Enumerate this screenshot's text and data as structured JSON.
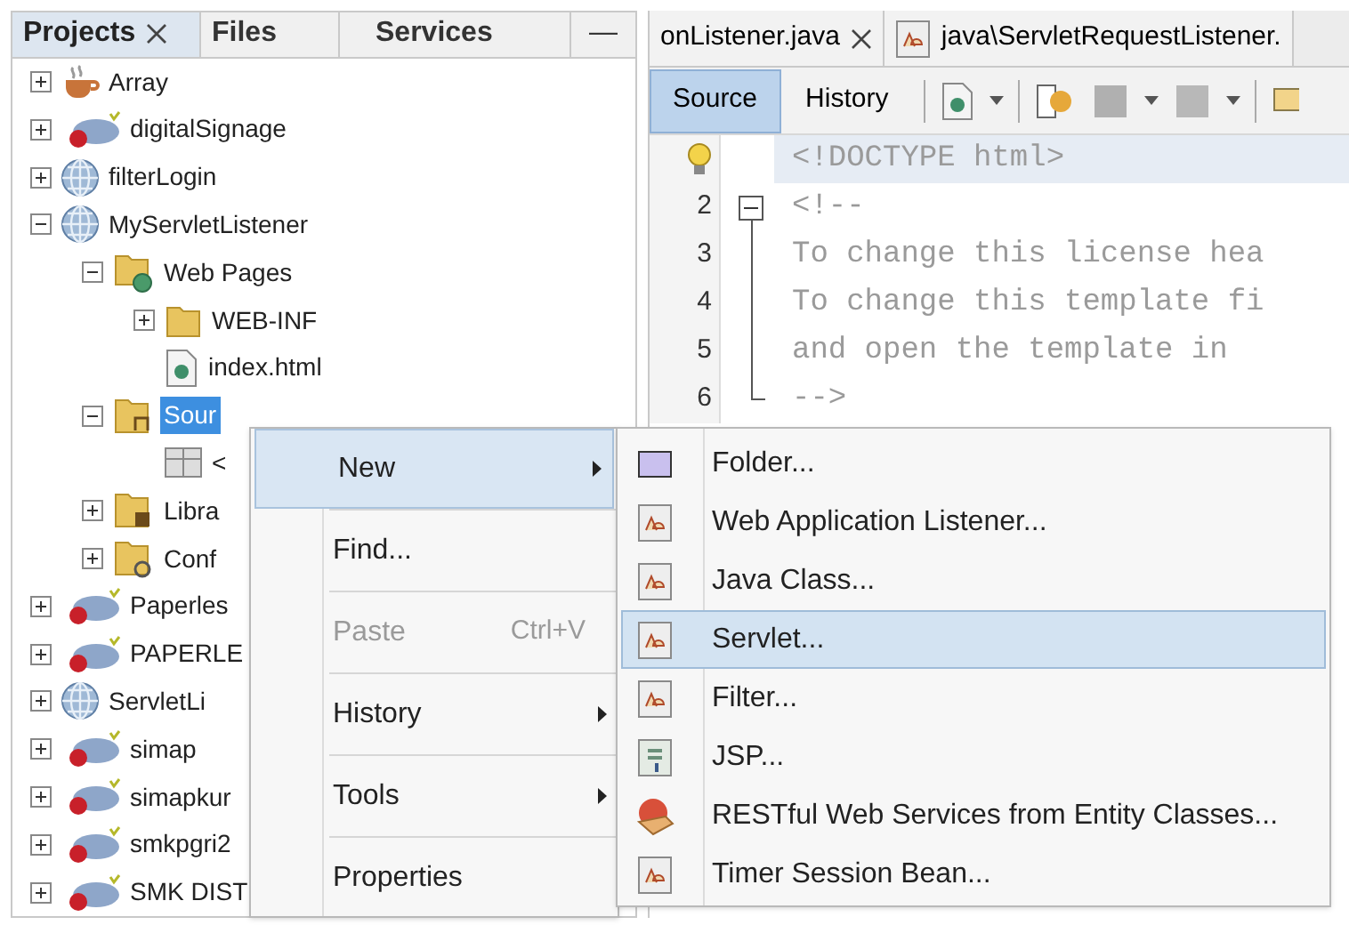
{
  "projects_panel": {
    "tabs": [
      {
        "label": "Projects",
        "selected": true,
        "closable": true
      },
      {
        "label": "Files",
        "selected": false,
        "closable": false
      },
      {
        "label": "Services",
        "selected": false,
        "closable": false
      }
    ],
    "minimize": "—",
    "tree": [
      {
        "label": "Array",
        "kind": "coffee",
        "expanded": false,
        "selected": false
      },
      {
        "label": "digitalSignage",
        "kind": "php",
        "expanded": false,
        "selected": false
      },
      {
        "label": "filterLogin",
        "kind": "globe",
        "expanded": false,
        "selected": false
      },
      {
        "label": "MyServletListener",
        "kind": "globe",
        "expanded": true,
        "selected": false,
        "children": [
          {
            "label": "Web Pages",
            "kind": "webfolder",
            "expanded": true,
            "selected": false,
            "children": [
              {
                "label": "WEB-INF",
                "kind": "folder",
                "expanded": false,
                "selected": false
              },
              {
                "label": "index.html",
                "kind": "html",
                "selected": false
              }
            ]
          },
          {
            "label": "Sour",
            "kind": "sourcefolder",
            "expanded": true,
            "selected": true,
            "children": [
              {
                "label": "<",
                "kind": "package",
                "selected": false
              }
            ]
          },
          {
            "label": "Libra",
            "kind": "libfolder",
            "expanded": false,
            "selected": false
          },
          {
            "label": "Conf",
            "kind": "conffolder",
            "expanded": false,
            "selected": false
          }
        ]
      },
      {
        "label": "Paperles",
        "kind": "php",
        "expanded": false,
        "selected": false
      },
      {
        "label": "PAPERLE",
        "kind": "php",
        "expanded": false,
        "selected": false
      },
      {
        "label": "ServletLi",
        "kind": "globe",
        "expanded": false,
        "selected": false
      },
      {
        "label": "simap",
        "kind": "php",
        "expanded": false,
        "selected": false
      },
      {
        "label": "simapkur",
        "kind": "php",
        "expanded": false,
        "selected": false
      },
      {
        "label": "smkpgri2",
        "kind": "php",
        "expanded": false,
        "selected": false
      },
      {
        "label": "SMK DIST",
        "kind": "php",
        "expanded": false,
        "selected": false
      }
    ]
  },
  "editor": {
    "file_tabs": [
      {
        "label": "onListener.java",
        "closable": true
      },
      {
        "label": "java\\ServletRequestListener.",
        "closable": false
      }
    ],
    "view_tabs": [
      {
        "label": "Source",
        "selected": true
      },
      {
        "label": "History",
        "selected": false
      }
    ],
    "lines": [
      {
        "kind": "hint",
        "text": "<!DOCTYPE html>",
        "current": true
      },
      {
        "kind": "fold_start",
        "number": "2",
        "text": "<!--",
        "current": false
      },
      {
        "kind": "fold_body",
        "number": "3",
        "text": "To change this license hea",
        "current": false
      },
      {
        "kind": "fold_body",
        "number": "4",
        "text": "To change this template fi",
        "current": false
      },
      {
        "kind": "fold_body",
        "number": "5",
        "text": "and open the template in",
        "current": false
      },
      {
        "kind": "fold_end",
        "number": "6",
        "text": "-->",
        "current": false
      }
    ]
  },
  "context_menu": {
    "items": [
      {
        "label": "New",
        "submenu": true,
        "selected": true,
        "disabled": false
      },
      {
        "label": "Find...",
        "submenu": false,
        "selected": false,
        "disabled": false
      },
      {
        "label": "Paste",
        "shortcut": "Ctrl+V",
        "submenu": false,
        "selected": false,
        "disabled": true
      },
      {
        "label": "History",
        "submenu": true,
        "selected": false,
        "disabled": false
      },
      {
        "label": "Tools",
        "submenu": true,
        "selected": false,
        "disabled": false
      },
      {
        "label": "Properties",
        "submenu": false,
        "selected": false,
        "disabled": false
      }
    ]
  },
  "submenu": {
    "items": [
      {
        "label": "Folder...",
        "kind": "folder",
        "selected": false
      },
      {
        "label": "Web Application Listener...",
        "kind": "class",
        "selected": false
      },
      {
        "label": "Java Class...",
        "kind": "class",
        "selected": false
      },
      {
        "label": "Servlet...",
        "kind": "class",
        "selected": true
      },
      {
        "label": "Filter...",
        "kind": "class",
        "selected": false
      },
      {
        "label": "JSP...",
        "kind": "jsp",
        "selected": false
      },
      {
        "label": "RESTful Web Services from Entity Classes...",
        "kind": "rest",
        "selected": false
      },
      {
        "label": "Timer Session Bean...",
        "kind": "class",
        "selected": false
      }
    ]
  }
}
